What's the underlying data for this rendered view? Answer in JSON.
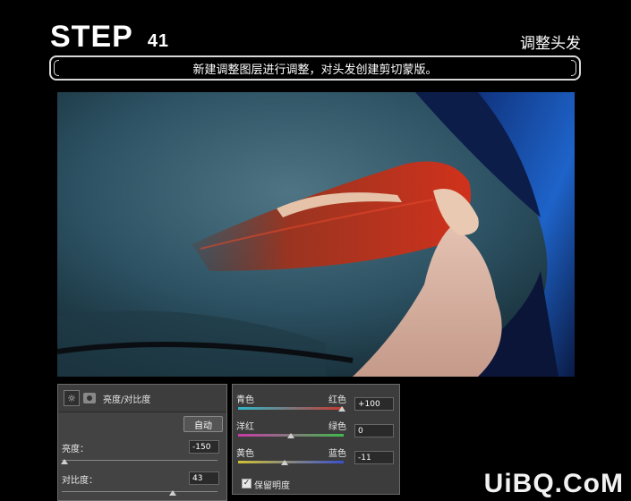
{
  "header": {
    "step_word": "STEP",
    "step_number": "41",
    "section_title": "调整头发"
  },
  "instruction": "新建调整图层进行调整，对头发创建剪切蒙版。",
  "photo": {
    "description_icon": "image"
  },
  "brightness_panel": {
    "title": "亮度/对比度",
    "auto_label": "自动",
    "brightness_label": "亮度：",
    "brightness_value": "-150",
    "contrast_label": "对比度：",
    "contrast_value": "43"
  },
  "color_balance": {
    "cyan_label": "青色",
    "red_label": "红色",
    "cyan_red_value": "+100",
    "magenta_label": "洋红",
    "green_label": "绿色",
    "magenta_green_value": "0",
    "yellow_label": "黄色",
    "blue_label": "蓝色",
    "yellow_blue_value": "-11",
    "preserve_label": "保留明度",
    "preserve_checked": true
  },
  "watermark": "UiBQ.CoM",
  "colors": {
    "background": "#000000",
    "panel": "#3a3a3a",
    "hair": "#c0331f",
    "sky": "#2f5566"
  }
}
